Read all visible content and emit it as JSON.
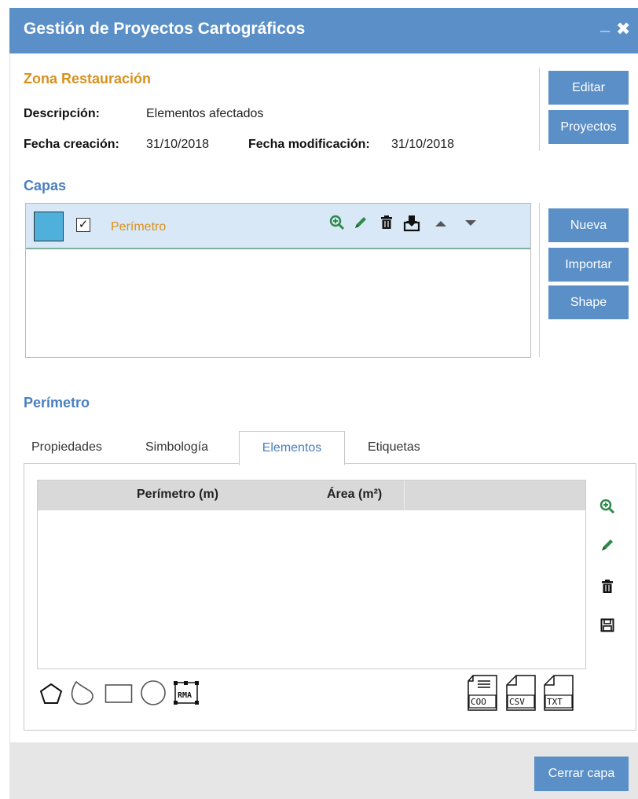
{
  "window": {
    "title": "Gestión de Proyectos Cartográficos",
    "minimize_glyph": "_",
    "close_glyph": "✖"
  },
  "project": {
    "name": "Zona Restauración",
    "description_label": "Descripción:",
    "description_value": "Elementos afectados",
    "created_label": "Fecha creación:",
    "created_value": "31/10/2018",
    "modified_label": "Fecha modificación:",
    "modified_value": "31/10/2018"
  },
  "project_buttons": {
    "edit": "Editar",
    "projects": "Proyectos"
  },
  "layers": {
    "title": "Capas",
    "items": [
      {
        "name": "Perímetro",
        "checked": true,
        "color": "#4fb0dc"
      }
    ],
    "buttons": {
      "new": "Nueva",
      "import": "Importar",
      "shape": "Shape"
    }
  },
  "layer_detail": {
    "title": "Perímetro",
    "tabs": [
      "Propiedades",
      "Simbología",
      "Elementos",
      "Etiquetas"
    ],
    "active_tab": "Elementos",
    "columns": [
      "Perímetro (m)",
      "Área (m²)"
    ],
    "export_labels": [
      "COO",
      "CSV",
      "TXT"
    ],
    "draw_tool_label": "RMA"
  },
  "footer": {
    "close_layer": "Cerrar capa"
  },
  "colors": {
    "accent": "#5b8fc7",
    "highlight": "#d9911c",
    "zoom_green": "#2f8a4a"
  }
}
